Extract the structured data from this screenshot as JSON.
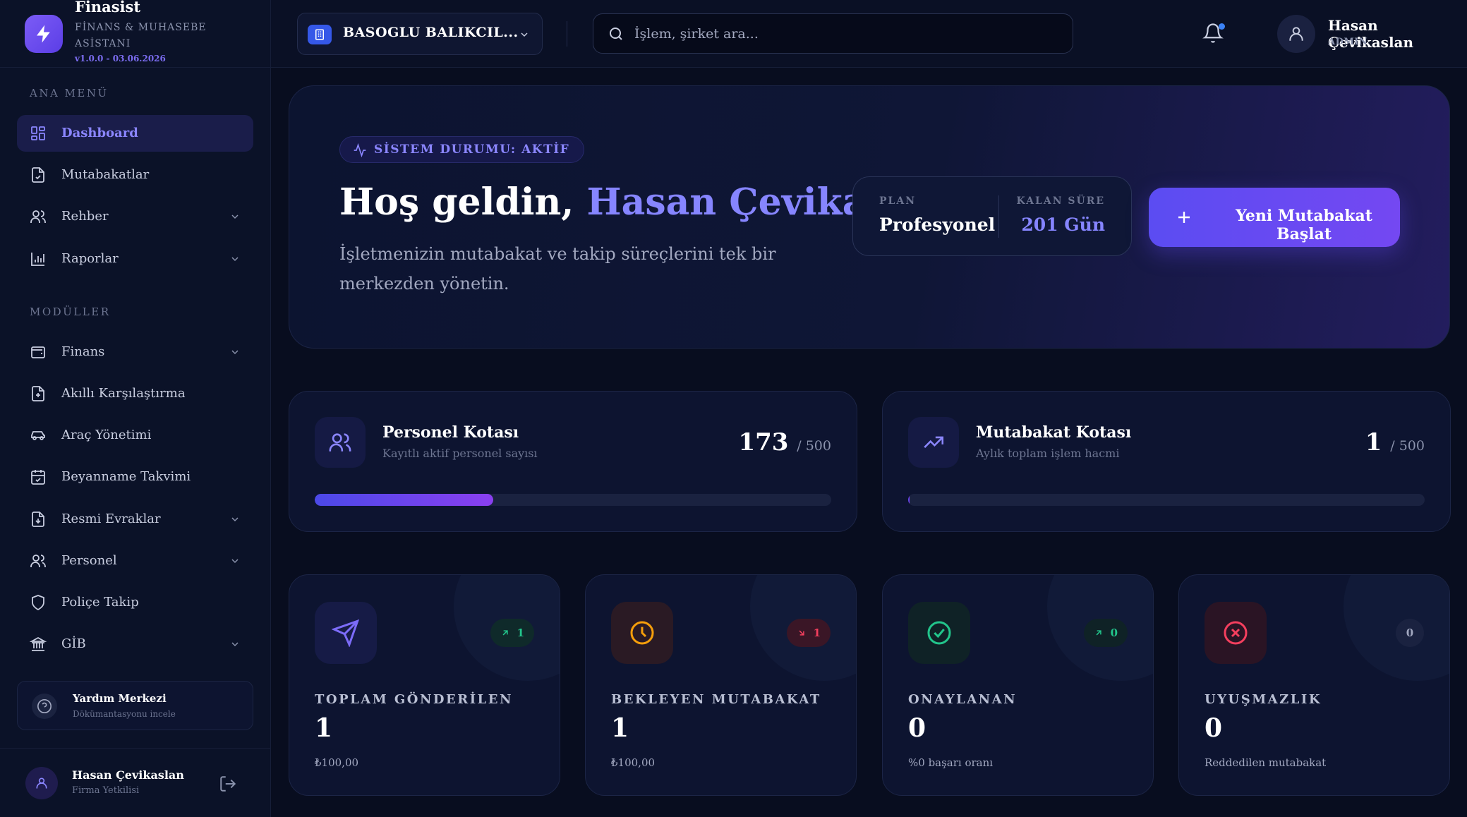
{
  "brand": {
    "name": "Finasist",
    "subtitle": "FİNANS & MUHASEBE ASİSTANI",
    "version": "v1.0.0 - 03.06.2026"
  },
  "sidebar": {
    "section_main": "ANA MENÜ",
    "section_modules": "MODÜLLER",
    "main_items": [
      {
        "label": "Dashboard",
        "icon": "grid-icon",
        "active": true
      },
      {
        "label": "Mutabakatlar",
        "icon": "document-check-icon"
      },
      {
        "label": "Rehber",
        "icon": "users-icon",
        "expandable": true
      },
      {
        "label": "Raporlar",
        "icon": "bar-chart-icon",
        "expandable": true
      }
    ],
    "module_items": [
      {
        "label": "Finans",
        "icon": "wallet-icon",
        "expandable": true
      },
      {
        "label": "Akıllı Karşılaştırma",
        "icon": "document-compare-icon"
      },
      {
        "label": "Araç Yönetimi",
        "icon": "car-icon"
      },
      {
        "label": "Beyanname Takvimi",
        "icon": "calendar-check-icon"
      },
      {
        "label": "Resmi Evraklar",
        "icon": "document-download-icon",
        "expandable": true
      },
      {
        "label": "Personel",
        "icon": "users-icon",
        "expandable": true
      },
      {
        "label": "Poliçe Takip",
        "icon": "shield-icon"
      },
      {
        "label": "GİB",
        "icon": "bank-icon",
        "expandable": true
      }
    ],
    "help": {
      "title": "Yardım Merkezi",
      "subtitle": "Dökümantasyonu incele"
    },
    "user": {
      "name": "Hasan Çevikaslan",
      "role": "Firma Yetkilisi"
    }
  },
  "topbar": {
    "company": "BASOGLU BALIKCIL...",
    "search_placeholder": "İşlem, şirket ara...",
    "user_name": "Hasan Çevikaslan",
    "user_role": "ADMIN"
  },
  "hero": {
    "status": "SİSTEM DURUMU: AKTİF",
    "greeting": "Hoş geldin,",
    "user": "Hasan Çevikaslan",
    "description": "İşletmenizin mutabakat ve takip süreçlerini tek bir merkezden yönetin.",
    "plan_label": "PLAN",
    "plan_value": "Profesyonel",
    "remaining_label": "KALAN SÜRE",
    "remaining_value": "201 Gün",
    "cta": "Yeni Mutabakat Başlat"
  },
  "quotas": [
    {
      "title": "Personel Kotası",
      "subtitle": "Kayıtlı aktif personel sayısı",
      "value": "173",
      "max": "/ 500",
      "fraction": 0.346
    },
    {
      "title": "Mutabakat Kotası",
      "subtitle": "Aylık toplam işlem hacmi",
      "value": "1",
      "max": "/ 500",
      "fraction": 0.002
    }
  ],
  "stats": [
    {
      "label": "TOPLAM GÖNDERİLEN",
      "value": "1",
      "sub": "₺100,00",
      "badge": "1",
      "trend": "up",
      "icon": "send-icon"
    },
    {
      "label": "BEKLEYEN MUTABAKAT",
      "value": "1",
      "sub": "₺100,00",
      "badge": "1",
      "trend": "down",
      "icon": "clock-icon"
    },
    {
      "label": "ONAYLANAN",
      "value": "0",
      "sub": "%0 başarı oranı",
      "badge": "0",
      "trend": "up",
      "icon": "check-circle-icon"
    },
    {
      "label": "UYUŞMAZLIK",
      "value": "0",
      "sub": "Reddedilen mutabakat",
      "badge": "0",
      "trend": "none",
      "icon": "x-circle-icon"
    }
  ],
  "colors": {
    "accent": "#8685ff",
    "primary_button": "#6249f0",
    "success": "#22c58b",
    "warning": "#f59e0b",
    "danger": "#f43f5e"
  }
}
